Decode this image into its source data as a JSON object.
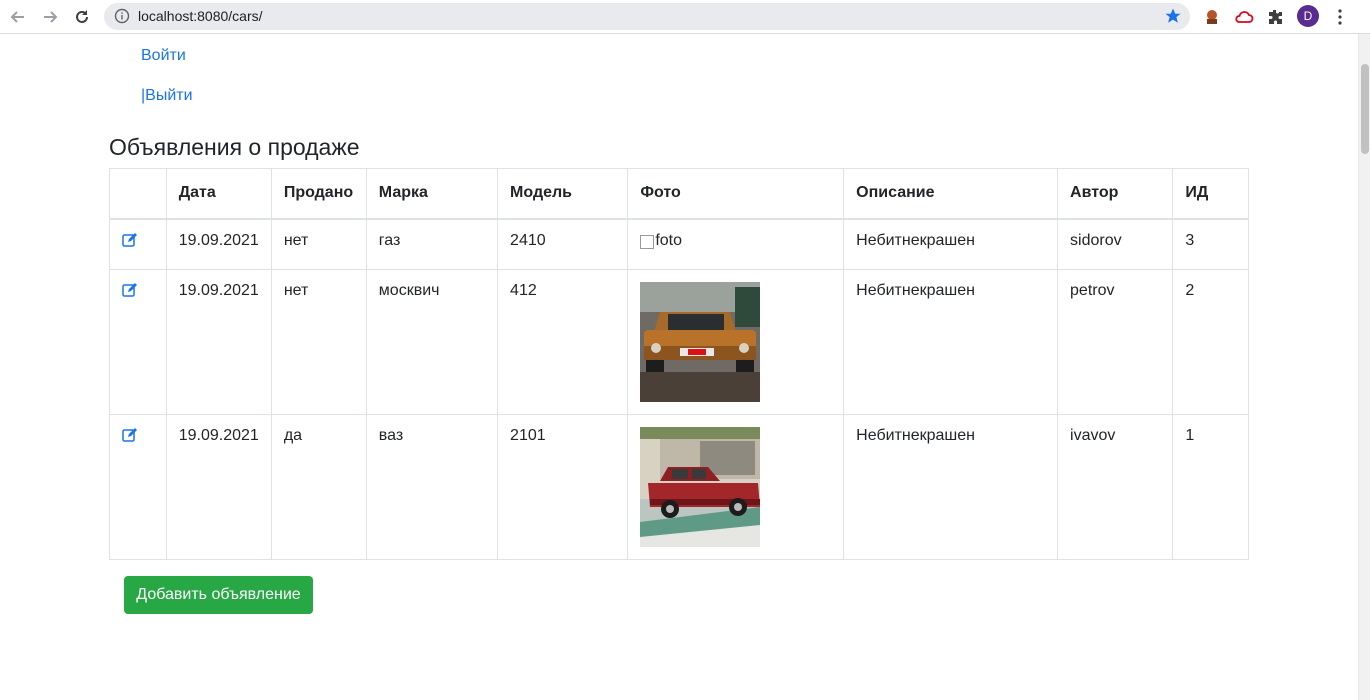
{
  "browser": {
    "url": "localhost:8080/cars/",
    "profile_initial": "D"
  },
  "auth": {
    "login_label": "Войти",
    "logout_separator": "|",
    "logout_label": "Выйти"
  },
  "page": {
    "title": "Объявления о продаже"
  },
  "table": {
    "headers": [
      "",
      "Дата",
      "Продано",
      "Марка",
      "Модель",
      "Фото",
      "Описание",
      "Автор",
      "ИД"
    ],
    "rows": [
      {
        "date": "19.09.2021",
        "sold": "нет",
        "brand": "газ",
        "model": "2410",
        "photo": "broken",
        "photo_alt": "foto",
        "description": "Небитнекрашен",
        "author": "sidorov",
        "id": "3"
      },
      {
        "date": "19.09.2021",
        "sold": "нет",
        "brand": "москвич",
        "model": "412",
        "photo": "orange-car",
        "description": "Небитнекрашен",
        "author": "petrov",
        "id": "2"
      },
      {
        "date": "19.09.2021",
        "sold": "да",
        "brand": "ваз",
        "model": "2101",
        "photo": "red-car",
        "description": "Небитнекрашен",
        "author": "ivavov",
        "id": "1"
      }
    ]
  },
  "actions": {
    "add_label": "Добавить объявление"
  },
  "colors": {
    "link": "#1a73e8",
    "add_button": "#28a745"
  }
}
